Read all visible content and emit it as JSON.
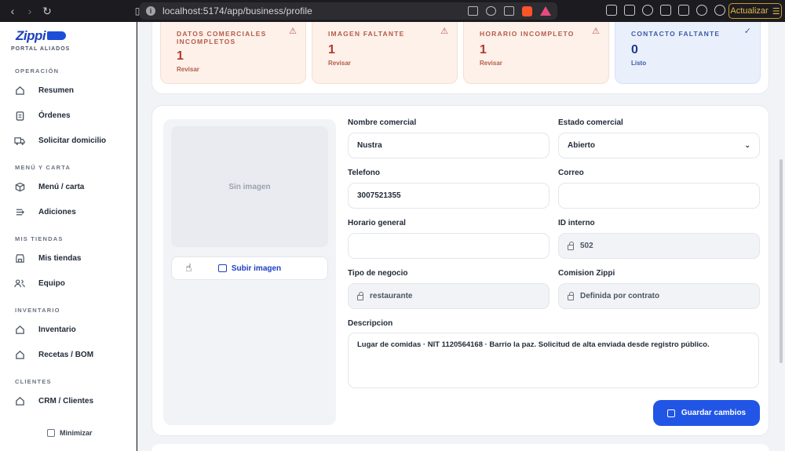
{
  "browser": {
    "url": "localhost:5174/app/business/profile",
    "update_label": "Actualizar"
  },
  "sidebar": {
    "brand": "Zippi",
    "portal": "PORTAL ALIADOS",
    "sections": {
      "operacion": "OPERACIÓN",
      "menu": "MENÚ Y CARTA",
      "tiendas": "MIS TIENDAS",
      "inventario": "INVENTARIO",
      "clientes": "CLIENTES"
    },
    "items": {
      "resumen": "Resumen",
      "ordenes": "Órdenes",
      "domicilio": "Solicitar domicilio",
      "menu": "Menú / carta",
      "adiciones": "Adiciones",
      "tiendas": "Mis tiendas",
      "equipo": "Equipo",
      "inventario": "Inventario",
      "recetas": "Recetas / BOM",
      "crm": "CRM / Clientes"
    },
    "minimize": "Minimizar"
  },
  "status_cards": [
    {
      "title": "DATOS COMERCIALES INCOMPLETOS",
      "count": "1",
      "action": "Revisar",
      "icon": "warning-icon"
    },
    {
      "title": "IMAGEN FALTANTE",
      "count": "1",
      "action": "Revisar",
      "icon": "warning-icon"
    },
    {
      "title": "HORARIO INCOMPLETO",
      "count": "1",
      "action": "Revisar",
      "icon": "warning-icon"
    },
    {
      "title": "CONTACTO FALTANTE",
      "count": "0",
      "action": "Listo",
      "icon": "check-circle-icon"
    }
  ],
  "image": {
    "empty": "Sin imagen",
    "upload": "Subir imagen"
  },
  "form": {
    "nombre_label": "Nombre comercial",
    "nombre_value": "Nustra",
    "estado_label": "Estado comercial",
    "estado_value": "Abierto",
    "telefono_label": "Telefono",
    "telefono_value": "3007521355",
    "correo_label": "Correo",
    "correo_value": "",
    "horario_label": "Horario general",
    "horario_value": "",
    "id_label": "ID interno",
    "id_value": "502",
    "tipo_label": "Tipo de negocio",
    "tipo_value": "restaurante",
    "comision_label": "Comision Zippi",
    "comision_value": "Definida por contrato",
    "descripcion_label": "Descripcion",
    "descripcion_value": "Lugar de comidas · NIT 1120564168 · Barrio la paz. Solicitud de alta enviada desde registro público.",
    "save": "Guardar cambios"
  },
  "colors": {
    "accent": "#2155e6",
    "warn_bg": "#fdf1ea",
    "ok_bg": "#eaf0fb"
  }
}
